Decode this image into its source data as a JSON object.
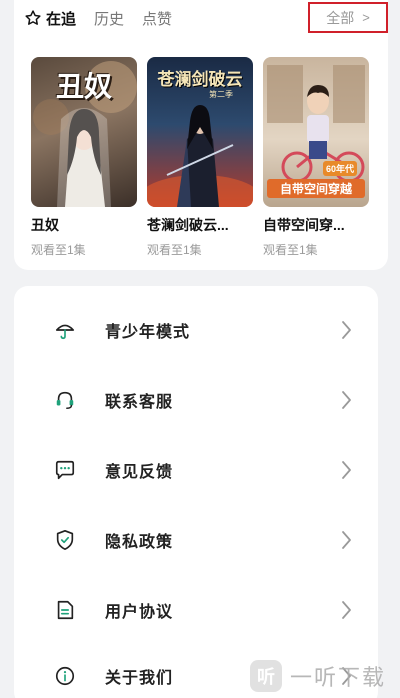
{
  "tabs": [
    {
      "label": "在追",
      "icon": "star-outline-icon"
    },
    {
      "label": "历史"
    },
    {
      "label": "点赞"
    }
  ],
  "all_button": {
    "label": "全部",
    "chevron": ">"
  },
  "dramas": [
    {
      "title": "丑奴",
      "poster_text": "丑奴",
      "progress": "观看至1集"
    },
    {
      "title": "苍澜剑破云...",
      "poster_text": "苍澜剑破云",
      "poster_subtext": "第二季",
      "progress": "观看至1集"
    },
    {
      "title": "自带空间穿...",
      "poster_text": "自带空间穿越",
      "poster_tag": "60年代",
      "progress": "观看至1集"
    }
  ],
  "menu": [
    {
      "label": "青少年模式",
      "icon": "umbrella-icon"
    },
    {
      "label": "联系客服",
      "icon": "headset-icon"
    },
    {
      "label": "意见反馈",
      "icon": "feedback-chat-icon"
    },
    {
      "label": "隐私政策",
      "icon": "shield-check-icon"
    },
    {
      "label": "用户协议",
      "icon": "document-icon"
    },
    {
      "label": "关于我们",
      "icon": "info-icon"
    }
  ],
  "watermark": {
    "logo": "听",
    "text": "一听下载"
  },
  "colors": {
    "accent": "#1fa27b",
    "highlight_box": "#d0202a",
    "background": "#f1f2f4"
  }
}
